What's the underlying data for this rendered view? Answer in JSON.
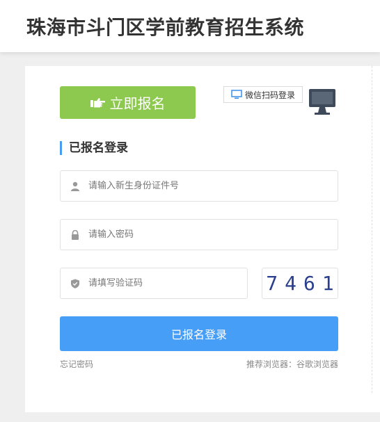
{
  "header": {
    "title": "珠海市斗门区学前教育招生系统"
  },
  "actions": {
    "signup_label": "立即报名",
    "wechat_login_label": "微信扫码登录"
  },
  "login": {
    "section_title": "已报名登录",
    "id_placeholder": "请输入新生身份证件号",
    "password_placeholder": "请输入密码",
    "captcha_placeholder": "请填写验证码",
    "captcha_code": "7461",
    "submit_label": "已报名登录",
    "forgot_label": "忘记密码",
    "browser_tip": "推荐浏览器：谷歌浏览器"
  },
  "icons": {
    "signup": "pointing-hand-icon",
    "wechat": "monitor-icon",
    "qr_toggle": "computer-monitor-icon",
    "id": "user-icon",
    "password": "lock-icon",
    "captcha": "shield-icon"
  },
  "colors": {
    "signup_green": "#8cc94e",
    "login_blue": "#479ef7",
    "accent_bar": "#4a9cf0",
    "captcha_text": "#2a3e8e"
  }
}
